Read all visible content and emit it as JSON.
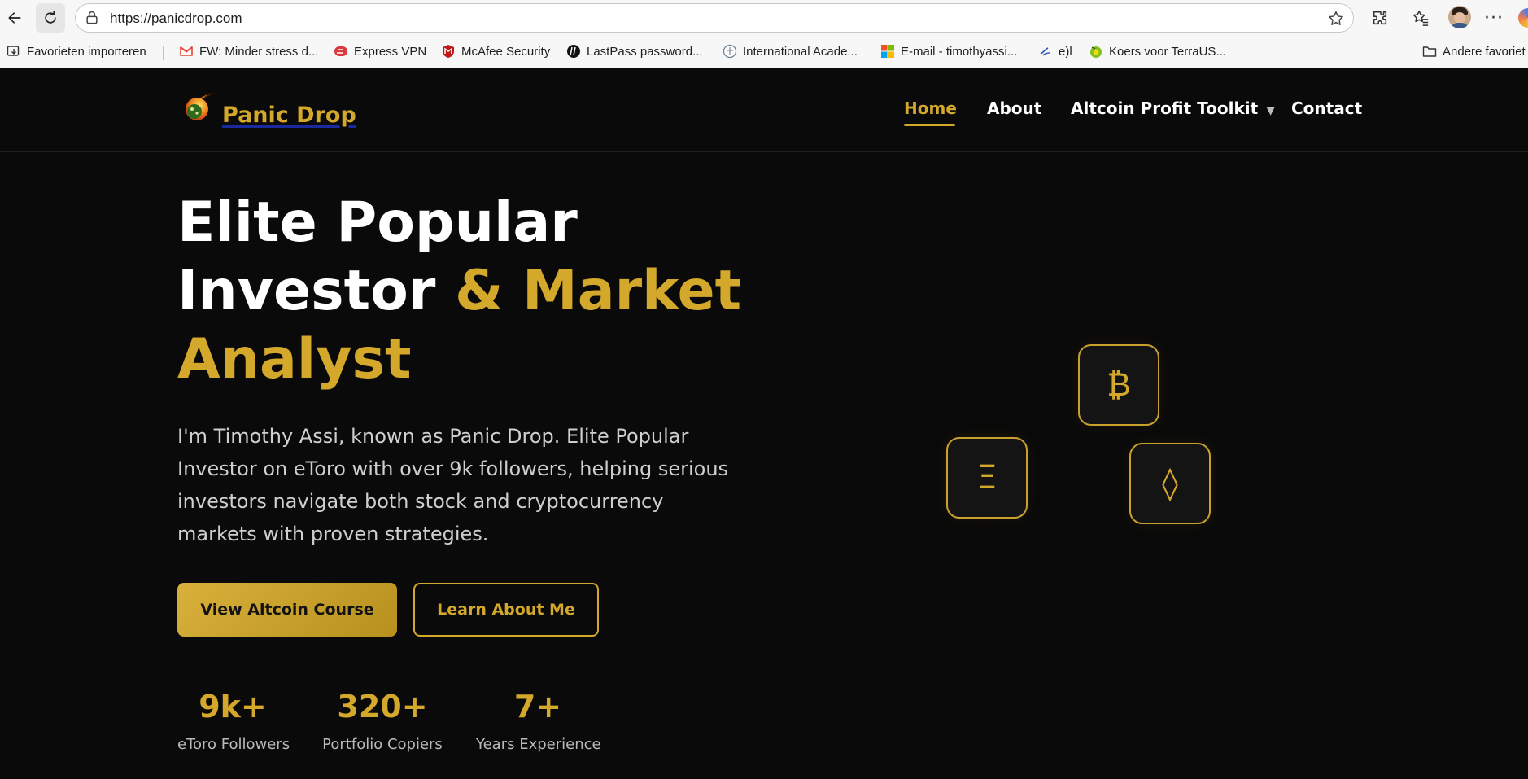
{
  "browser": {
    "url": "https://panicdrop.com",
    "bookmarks": [
      {
        "label": "Favorieten importeren",
        "icon": "import-favorites-icon"
      },
      {
        "label": "FW: Minder stress d...",
        "icon": "gmail-icon"
      },
      {
        "label": "Express VPN",
        "icon": "expressvpn-icon"
      },
      {
        "label": "McAfee Security",
        "icon": "mcafee-icon"
      },
      {
        "label": "LastPass password...",
        "icon": "hp-icon"
      },
      {
        "label": "International Acade...",
        "icon": "academy-icon"
      },
      {
        "label": "E-mail - timothyassi...",
        "icon": "microsoft-icon"
      },
      {
        "label": "e)l",
        "icon": "bookmark-icon"
      },
      {
        "label": "Koers voor TerraUS...",
        "icon": "coin-icon"
      },
      {
        "label": "Andere favoriet",
        "icon": "folder-icon"
      }
    ]
  },
  "site": {
    "brand": "Panic Drop",
    "nav": [
      {
        "label": "Home",
        "active": true
      },
      {
        "label": "About"
      },
      {
        "label": "Altcoin Profit Toolkit",
        "has_dropdown": true
      },
      {
        "label": "Contact"
      }
    ],
    "caret": "▼"
  },
  "hero": {
    "title_line1": "Elite Popular",
    "title_line2_white": "Investor ",
    "title_line2_gold": "& Market",
    "title_line3": "Analyst",
    "description": "I'm Timothy Assi, known as Panic Drop. Elite Popular Investor on eToro with over 9k followers, helping serious investors navigate both stock and cryptocurrency markets with proven strategies.",
    "primary_button": "View Altcoin Course",
    "secondary_button": "Learn About Me",
    "stats": [
      {
        "value": "9k+",
        "label": "eToro Followers"
      },
      {
        "value": "320+",
        "label": "Portfolio Copiers"
      },
      {
        "value": "7+",
        "label": "Years Experience"
      }
    ],
    "crypto_symbols": [
      "₿",
      "Ξ",
      "◊"
    ]
  },
  "colors": {
    "accent": "#d4a82a",
    "background": "#0a0a0a"
  }
}
